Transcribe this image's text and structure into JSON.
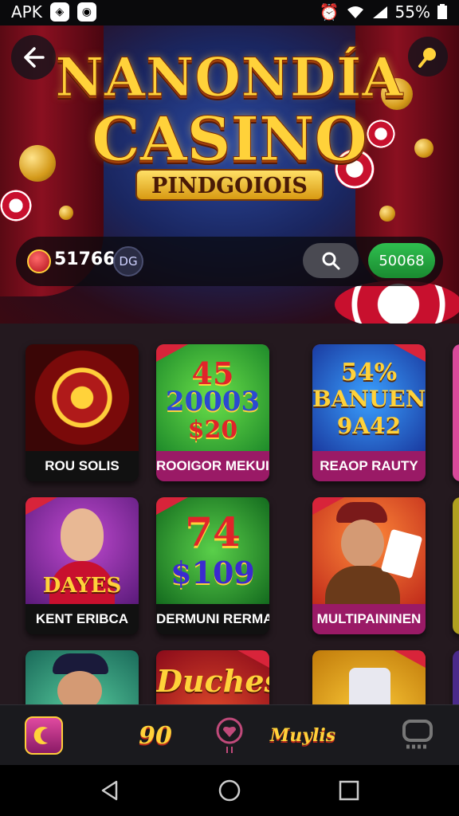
{
  "status_bar": {
    "app_label": "APK",
    "battery": "55%"
  },
  "hero": {
    "title_line1": "NANONDÍA",
    "title_line2": "CASINO",
    "subtitle": "PINDGOIOIS",
    "balance": "517666",
    "currency_badge": "DG",
    "action_button": "50068"
  },
  "games": [
    {
      "label": "ROU SOLIS",
      "art_text": ""
    },
    {
      "label": "ROOIGOR MEKUIS",
      "art_text_1": "45",
      "art_text_2": "20003",
      "art_text_3": "$20"
    },
    {
      "label": "REAOP RAUTY",
      "art_text_1": "54%",
      "art_text_2": "BANUEN",
      "art_text_3": "9A42"
    },
    {
      "label": "KENT ERIBCA",
      "art_text": "DAYES"
    },
    {
      "label": "DERMUNI RERMAM",
      "art_text_1": "74",
      "art_text_2": "$109"
    },
    {
      "label": "MULTIPAININEN",
      "art_text": ""
    },
    {
      "label": "",
      "art_text": ""
    },
    {
      "label": "",
      "art_text": "Duches"
    },
    {
      "label": "",
      "art_text": ""
    }
  ],
  "bottom_nav": {
    "item1": "",
    "item2": "90",
    "item3": "",
    "item4": "Muylis",
    "item5": ""
  },
  "colors": {
    "accent_gold": "#ffd23a",
    "green": "#2fbf4f",
    "red": "#d8243a"
  }
}
